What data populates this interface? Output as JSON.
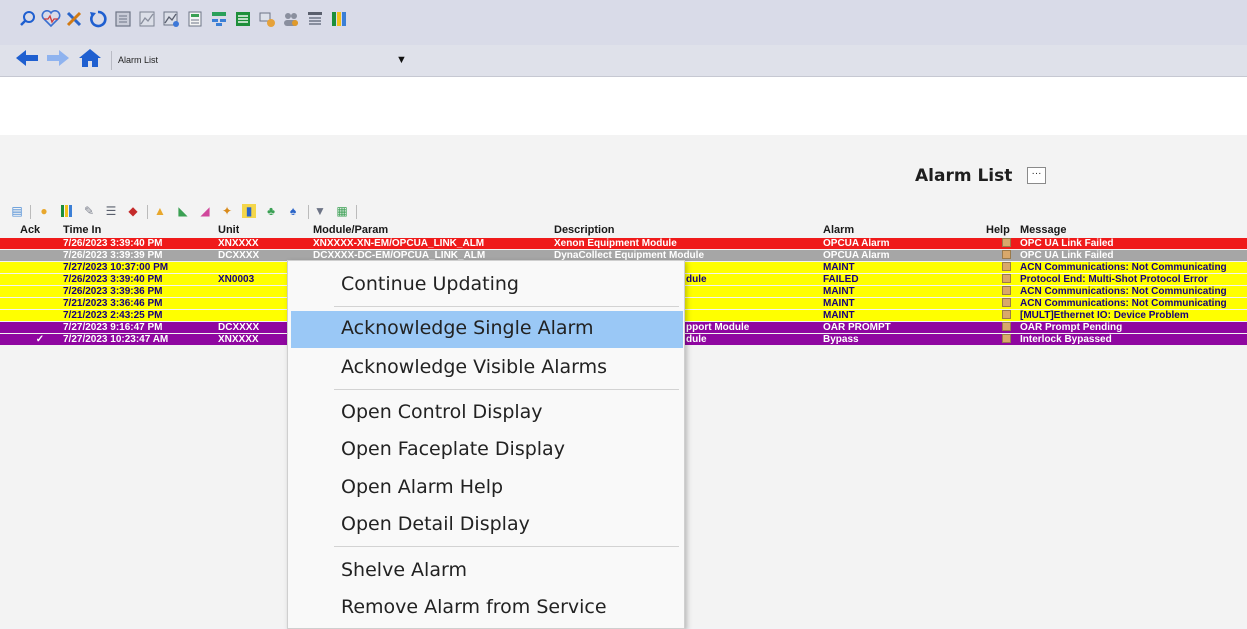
{
  "toolbar": {
    "icons": [
      "search-icon",
      "heartbeat-icon",
      "tools-icon",
      "refresh-icon",
      "report-icon",
      "chart-icon",
      "chart-edit-icon",
      "document-icon",
      "network-icon",
      "list-icon",
      "module-icon",
      "user-group-icon",
      "alarm-list-icon",
      "columns-icon"
    ]
  },
  "nav": {
    "back_icon": "back-arrow-icon",
    "forward_icon": "forward-arrow-icon",
    "home_icon": "home-icon",
    "title": "Alarm List",
    "dropdown_glyph": "▼"
  },
  "panel": {
    "title": "Alarm List",
    "ellipsis": "···"
  },
  "columns": {
    "ack": "Ack",
    "time_in": "Time In",
    "unit": "Unit",
    "module": "Module/Param",
    "description": "Description",
    "alarm": "Alarm",
    "help": "Help",
    "message": "Message"
  },
  "colors": {
    "red": "#ef1a1a",
    "gray": "#a6a6a6",
    "yellow": "#ffff00",
    "purple": "#8f07a0"
  },
  "rows": [
    {
      "ack": "",
      "time": "7/26/2023 3:39:40 PM",
      "unit": "XNXXXX",
      "module": "XNXXXX-XN-EM/OPCUA_LINK_ALM",
      "description": "Xenon Equipment Module",
      "alarm": "OPCUA Alarm",
      "message": "OPC UA Link Failed"
    },
    {
      "ack": "",
      "time": "7/26/2023 3:39:39 PM",
      "unit": "DCXXXX",
      "module": "DCXXXX-DC-EM/OPCUA_LINK_ALM",
      "description": "DynaCollect Equipment Module",
      "alarm": "OPCUA Alarm",
      "message": "OPC UA Link Failed"
    },
    {
      "ack": "",
      "time": "7/27/2023 10:37:00 PM",
      "unit": "",
      "module": "",
      "description": "",
      "alarm": "MAINT",
      "message": "ACN Communications: Not Communicating"
    },
    {
      "ack": "",
      "time": "7/26/2023 3:39:40 PM",
      "unit": "XN0003",
      "module": "",
      "description": "dule",
      "alarm": "FAILED",
      "message": "Protocol End: Multi-Shot Protocol Error"
    },
    {
      "ack": "",
      "time": "7/26/2023 3:39:36 PM",
      "unit": "",
      "module": "",
      "description": "",
      "alarm": "MAINT",
      "message": "ACN Communications: Not Communicating"
    },
    {
      "ack": "",
      "time": "7/21/2023 3:36:46 PM",
      "unit": "",
      "module": "",
      "description": "",
      "alarm": "MAINT",
      "message": "ACN Communications: Not Communicating"
    },
    {
      "ack": "",
      "time": "7/21/2023 2:43:25 PM",
      "unit": "",
      "module": "",
      "description": "",
      "alarm": "MAINT",
      "message": "[MULT]Ethernet IO: Device Problem"
    },
    {
      "ack": "",
      "time": "7/27/2023 9:16:47 PM",
      "unit": "DCXXXX",
      "module": "",
      "description": "pport Module",
      "alarm": "OAR PROMPT",
      "message": "OAR Prompt Pending"
    },
    {
      "ack": "✓",
      "time": "7/27/2023 10:23:47 AM",
      "unit": "XNXXXX",
      "module": "",
      "description": "dule",
      "alarm": "Bypass",
      "message": "Interlock Bypassed"
    }
  ],
  "context_menu": {
    "items": [
      {
        "label": "Continue Updating"
      },
      {
        "label": "Acknowledge Single Alarm"
      },
      {
        "label": "Acknowledge Visible Alarms"
      },
      {
        "label": "Open Control Display"
      },
      {
        "label": "Open Faceplate Display"
      },
      {
        "label": "Open Alarm Help"
      },
      {
        "label": "Open Detail Display"
      },
      {
        "label": "Shelve Alarm"
      },
      {
        "label": "Remove Alarm from Service"
      }
    ]
  }
}
